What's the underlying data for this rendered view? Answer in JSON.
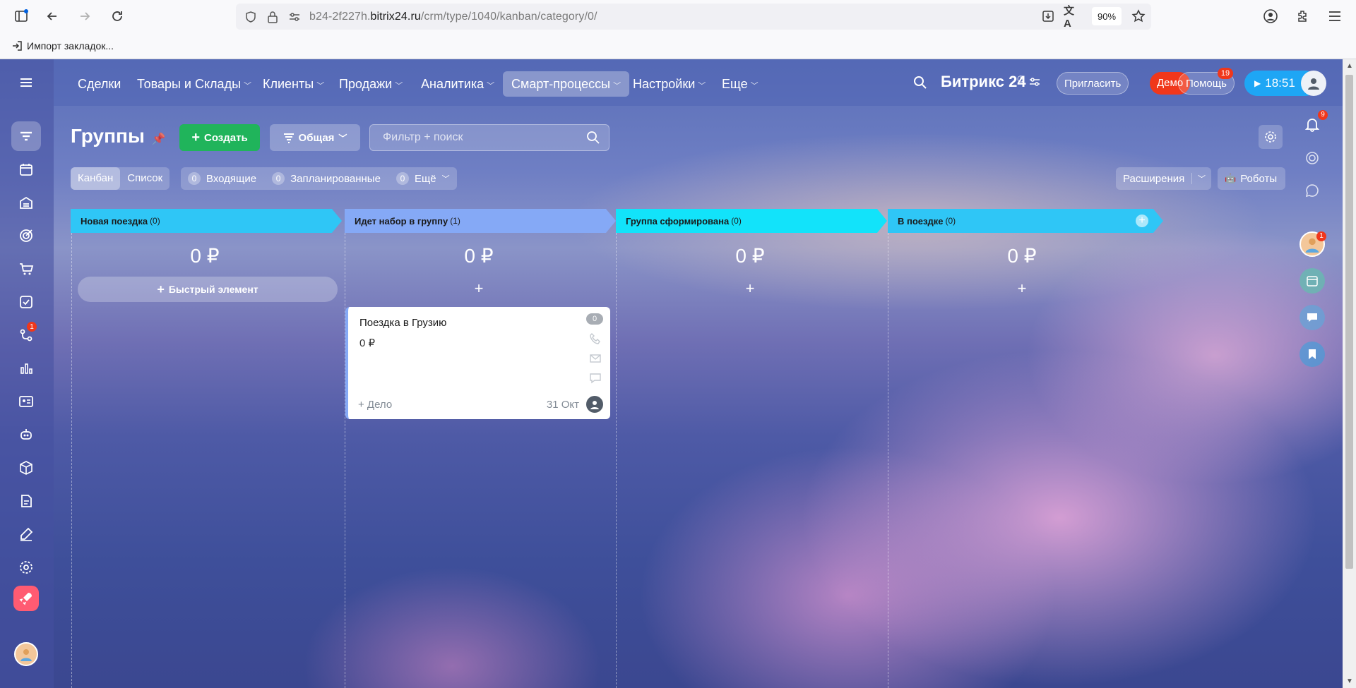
{
  "browser": {
    "url_prefix": "b24-2f227h.",
    "url_domain": "bitrix24.ru",
    "url_path": "/crm/type/1040/kanban/category/0/",
    "zoom": "90%",
    "bookmark_import": "Импорт закладок..."
  },
  "menu": {
    "items": [
      "Сделки",
      "Товары и Склады",
      "Клиенты",
      "Продажи",
      "Аналитика",
      "Смарт-процессы",
      "Настройки",
      "Еще"
    ],
    "brand": "Битрикс 24",
    "invite": "Пригласить",
    "demo": "Демо",
    "help": "Помощь",
    "help_count": "19",
    "time": "18:51"
  },
  "leftnav": {
    "badge": "1"
  },
  "toolbar": {
    "title": "Группы",
    "create": "Создать",
    "category": "Общая",
    "search_placeholder": "Фильтр + поиск",
    "view_kanban": "Канбан",
    "view_list": "Список",
    "incoming_count": "0",
    "incoming": "Входящие",
    "planned_count": "0",
    "planned": "Запланированные",
    "more_count": "0",
    "more": "Ещё",
    "extensions": "Расширения",
    "robots": "Роботы"
  },
  "columns": [
    {
      "title": "Новая поездка",
      "count": "(0)",
      "sum": "0 ₽",
      "color": "#2fc6f6"
    },
    {
      "title": "Идет набор в группу",
      "count": "(1)",
      "sum": "0 ₽",
      "color": "#85a9f6"
    },
    {
      "title": "Группа сформирована",
      "count": "(0)",
      "sum": "0 ₽",
      "color": "#12e3fa"
    },
    {
      "title": "В поездке",
      "count": "(0)",
      "sum": "0 ₽",
      "color": "#2fc6f6"
    }
  ],
  "quick_item": "Быстрый элемент",
  "card": {
    "title": "Поездка в Грузию",
    "sum": "0 ₽",
    "badge": "0",
    "deal": "+ Дело",
    "date": "31 Окт"
  },
  "right_sidebar": {
    "notifications": "9",
    "avatar_badge": "1"
  }
}
